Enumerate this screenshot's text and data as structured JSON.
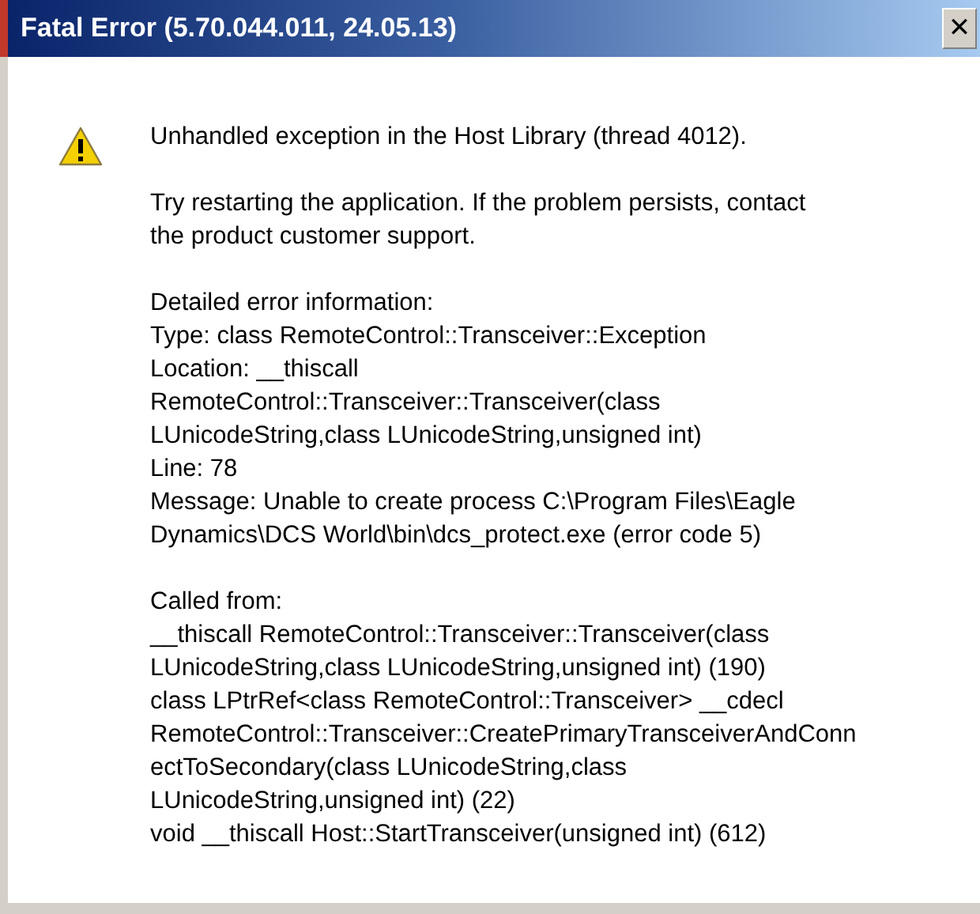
{
  "window": {
    "title": "Fatal Error (5.70.044.011, 24.05.13)",
    "close": "✕"
  },
  "paragraphs": [
    {
      "lines": [
        "Unhandled exception in the Host Library (thread 4012)."
      ]
    },
    {
      "lines": [
        "Try restarting the application. If the problem persists, contact",
        "the product customer support."
      ]
    },
    {
      "lines": [
        "Detailed error information:",
        "Type: class RemoteControl::Transceiver::Exception",
        "Location: __thiscall",
        "RemoteControl::Transceiver::Transceiver(class",
        "LUnicodeString,class LUnicodeString,unsigned int)",
        "Line: 78",
        "Message: Unable to create process C:\\Program Files\\Eagle",
        "Dynamics\\DCS World\\bin\\dcs_protect.exe (error code 5)"
      ]
    },
    {
      "lines": [
        "Called from:",
        "__thiscall RemoteControl::Transceiver::Transceiver(class",
        "LUnicodeString,class LUnicodeString,unsigned int) (190)",
        "class LPtrRef<class RemoteControl::Transceiver> __cdecl",
        "RemoteControl::Transceiver::CreatePrimaryTransceiverAndConn",
        "ectToSecondary(class LUnicodeString,class",
        "LUnicodeString,unsigned int) (22)",
        "void __thiscall Host::StartTransceiver(unsigned int) (612)"
      ]
    }
  ]
}
